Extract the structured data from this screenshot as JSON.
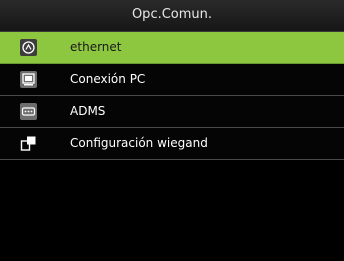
{
  "header": {
    "title": "Opc.Comun."
  },
  "menu": {
    "items": [
      {
        "label": "ethernet",
        "icon": "ethernet-icon",
        "selected": true
      },
      {
        "label": "Conexión PC",
        "icon": "pc-connection-icon",
        "selected": false
      },
      {
        "label": "ADMS",
        "icon": "adms-icon",
        "selected": false
      },
      {
        "label": "Configuración wiegand",
        "icon": "wiegand-icon",
        "selected": false
      }
    ]
  },
  "colors": {
    "selected_background": "#8dc63f",
    "background": "#000000",
    "icon_background": "#6e6e6e"
  }
}
